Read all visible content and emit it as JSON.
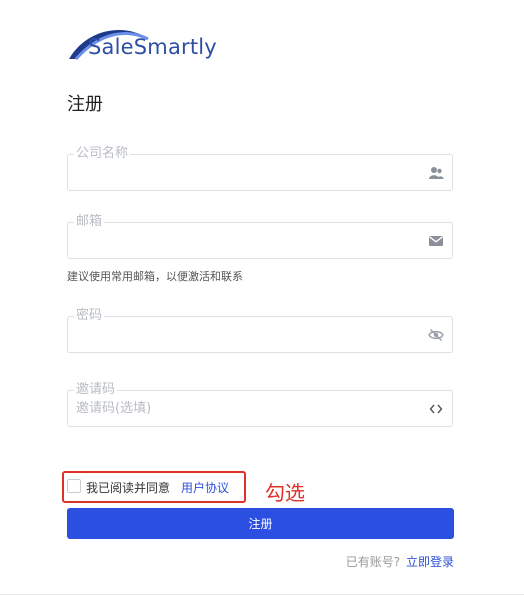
{
  "brand": {
    "name": "SaleSmartly"
  },
  "page": {
    "title": "注册"
  },
  "form": {
    "company": {
      "label": "公司名称",
      "value": "",
      "icon": "company-users-icon"
    },
    "email": {
      "label": "邮箱",
      "value": "",
      "icon": "envelope-icon",
      "hint": "建议使用常用邮箱，以便激活和联系"
    },
    "password": {
      "label": "密码",
      "value": "",
      "icon": "eye-off-icon"
    },
    "invite": {
      "label": "邀请码",
      "placeholder": "邀请码(选填)",
      "icon": "code-brackets-icon"
    },
    "agree": {
      "text": "我已阅读并同意",
      "link": "用户协议",
      "checked": false
    },
    "submit_label": "注册",
    "login_prompt": "已有账号?",
    "login_link": "立即登录"
  },
  "annotation": {
    "text": "勾选",
    "color": "#e0302a"
  },
  "colors": {
    "primary": "#2b4fe0",
    "brand": "#2d4fa3"
  }
}
